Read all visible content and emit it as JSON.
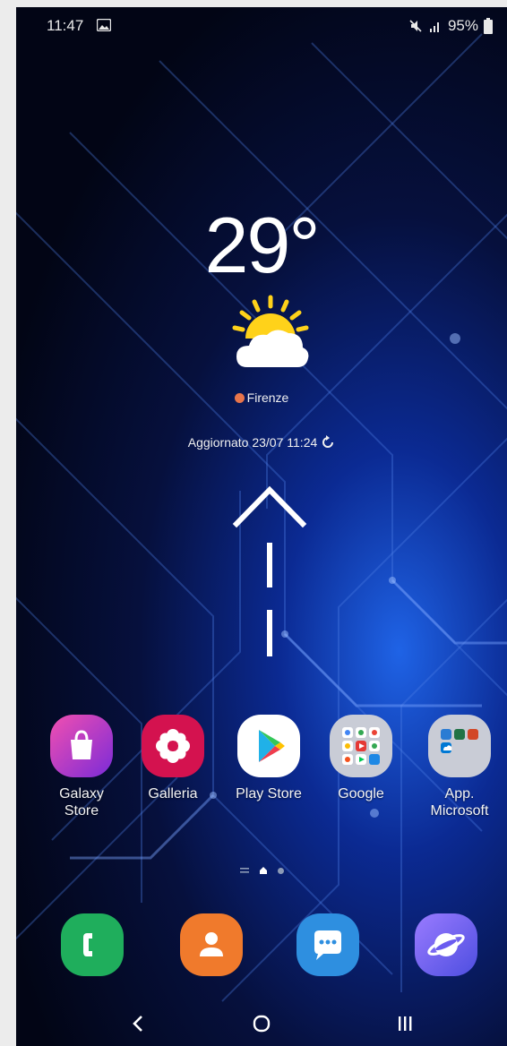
{
  "status_bar": {
    "time": "11:47",
    "battery_percent": "95%",
    "icons": [
      "gallery-notification-icon",
      "mute-icon",
      "signal-icon",
      "battery-icon"
    ]
  },
  "weather": {
    "temperature": "29°",
    "condition_icon": "partly-sunny-icon",
    "city": "Firenze",
    "updated": "Aggiornato 23/07 11:24"
  },
  "gesture_hint": {
    "icon": "swipe-up-arrow-icon"
  },
  "apps": [
    {
      "label": "Galaxy\nStore",
      "icon": "galaxy-store-icon",
      "color": "#c6279a"
    },
    {
      "label": "Galleria",
      "icon": "gallery-flower-icon",
      "color": "#d4124f"
    },
    {
      "label": "Play Store",
      "icon": "play-store-icon",
      "color": "#ffffff"
    },
    {
      "label": "Google",
      "icon": "google-folder-icon",
      "color": "#c9ccd6"
    },
    {
      "label": "App.\nMicrosoft",
      "icon": "microsoft-folder-icon",
      "color": "#c9ccd6"
    }
  ],
  "page_indicator": {
    "pages": 3,
    "current_page": 2
  },
  "dock": [
    {
      "icon": "phone-icon",
      "color": "#1fae5c"
    },
    {
      "icon": "contacts-icon",
      "color": "#f07a2c"
    },
    {
      "icon": "messages-icon",
      "color": "#2e8fe0"
    },
    {
      "icon": "internet-browser-icon",
      "color": "#7b6cff"
    }
  ],
  "nav_bar": {
    "buttons": [
      "back-icon",
      "home-icon",
      "recents-icon"
    ]
  }
}
